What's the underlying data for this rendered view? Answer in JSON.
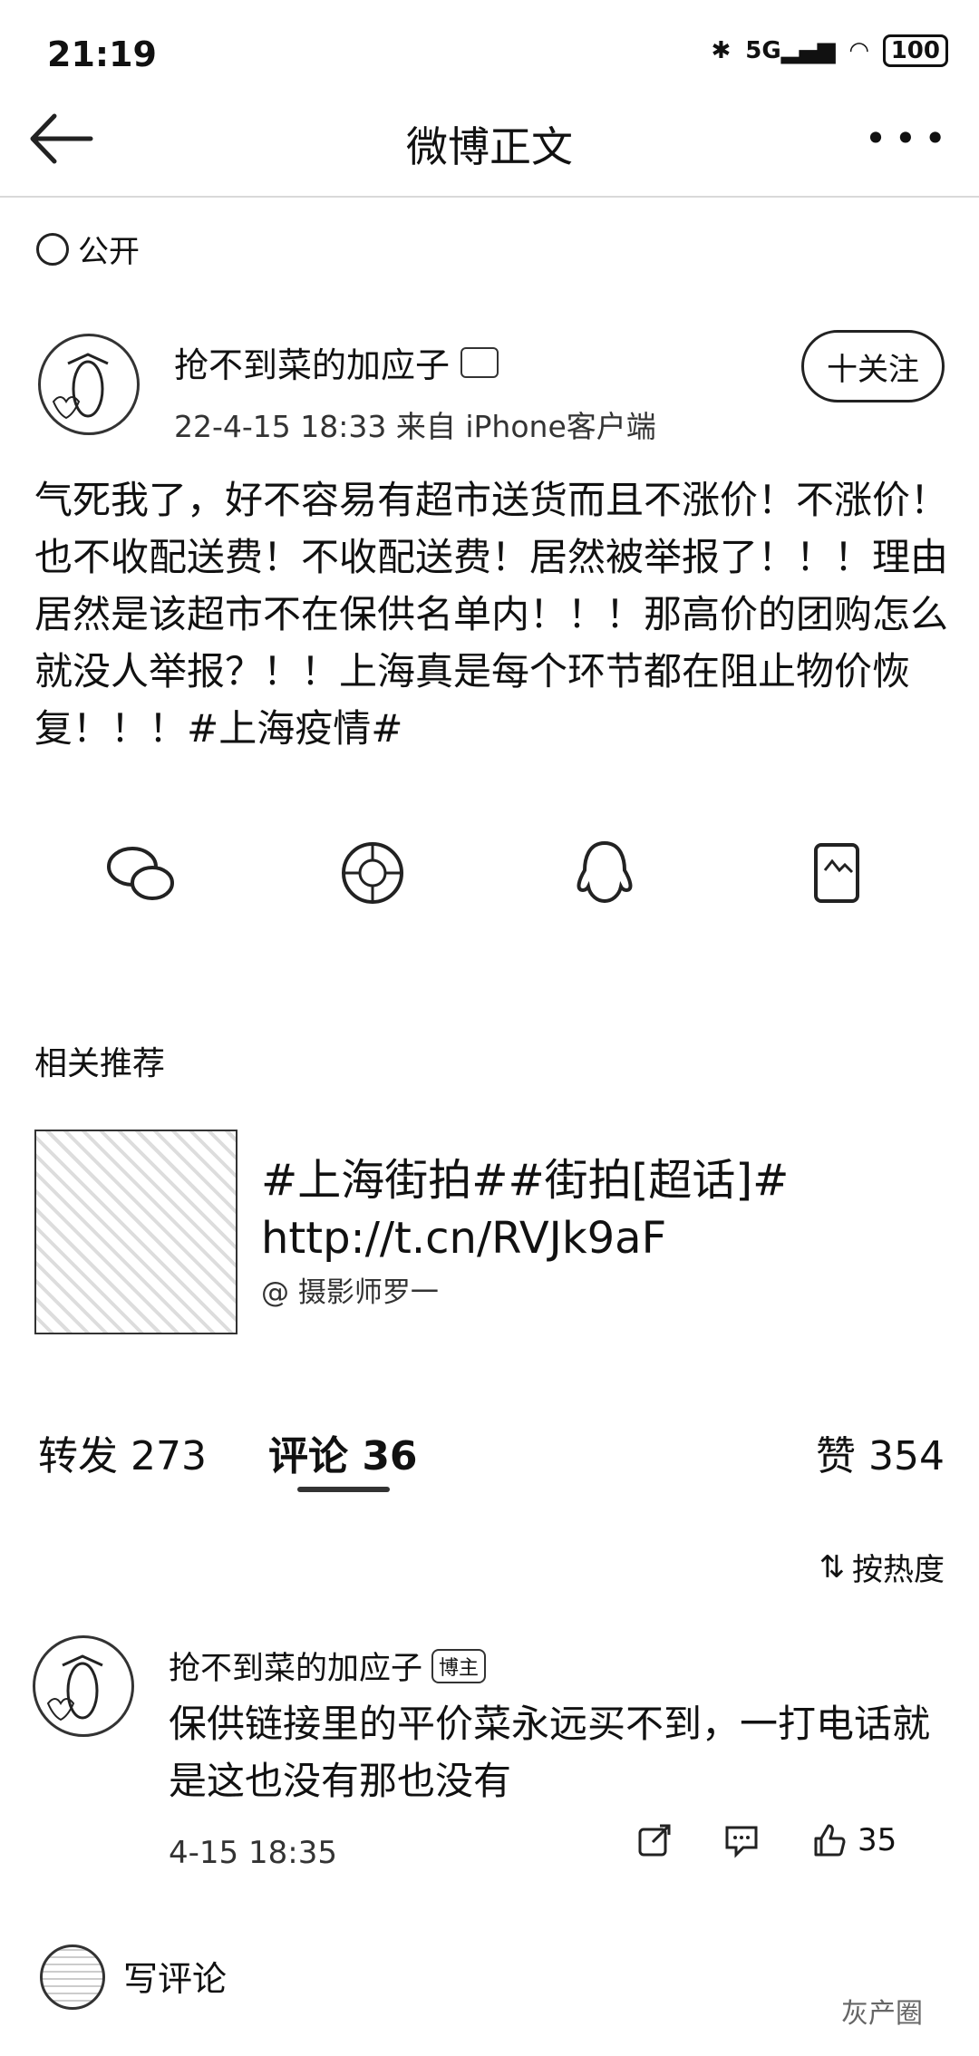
{
  "status_bar": {
    "time": "21:19",
    "battery": "100"
  },
  "nav": {
    "title": "微博正文"
  },
  "post": {
    "visibility": "公开",
    "author": "抢不到菜的加应子",
    "meta": "22-4-15  18:33  来自  iPhone客户端",
    "follow_label": "十关注",
    "text": "气死我了，好不容易有超市送货而且不涨价！不涨价！也不收配送费！不收配送费！居然被举报了！！！理由居然是该超市不在保供名单内！！！那高价的团购怎么就没人举报？！！上海真是每个环节都在阻止物价恢复！！！#上海疫情#"
  },
  "share_icons": [
    "wechat-icon",
    "moments-icon",
    "qq-icon",
    "save-image-icon"
  ],
  "recommend": {
    "section_title": "相关推荐",
    "text": "#上海街拍##街拍[超话]#\nhttp://t.cn/RVJk9aF",
    "author": "@ 摄影师罗一"
  },
  "tabs": {
    "repost": "转发  273",
    "comment": "评论  36",
    "like": "赞  354"
  },
  "sort_label": "按热度",
  "comment": {
    "author": "抢不到菜的加应子",
    "badge": "博主",
    "text": "保供链接里的平价菜永远买不到，一打电话就是这也没有那也没有",
    "time": "4-15  18:35",
    "likes": "35"
  },
  "composer": {
    "label": "写评论"
  },
  "watermark": "灰产圈"
}
